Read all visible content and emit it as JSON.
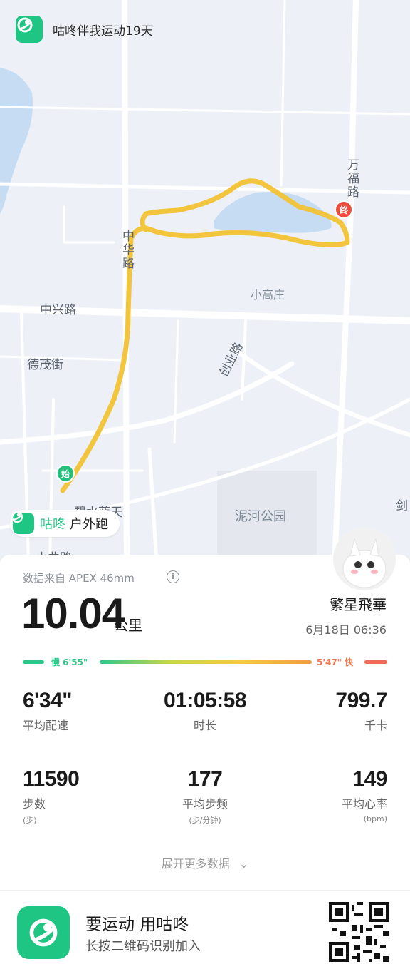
{
  "banner": {
    "text": "咕咚伴我运动19天"
  },
  "map": {
    "roads": [
      "万福路",
      "中华路",
      "中兴路",
      "德茂街",
      "创业路",
      "碧水蓝天",
      "小曲路",
      "剑"
    ],
    "places": [
      "小高庄",
      "泥河公园"
    ],
    "start_marker": "始",
    "end_marker": "终"
  },
  "sport_tag": {
    "brand": "咕咚",
    "type": "户外跑"
  },
  "summary": {
    "source": "数据来自 APEX 46mm",
    "distance": "10.04",
    "distance_unit": "公里",
    "user": "繁星飛華",
    "datetime": "6月18日 06:36"
  },
  "pace_scale": {
    "slow_label": "慢 6'55\"",
    "fast_label": "5'47\" 快"
  },
  "stats": {
    "pace": {
      "value": "6'34\"",
      "label": "平均配速"
    },
    "duration": {
      "value": "01:05:58",
      "label": "时长"
    },
    "calories": {
      "value": "799.7",
      "label": "千卡"
    },
    "steps": {
      "value": "11590",
      "label": "步数",
      "unit": "(步)"
    },
    "cadence": {
      "value": "177",
      "label": "平均步频",
      "unit": "(步/分钟)"
    },
    "heart_rate": {
      "value": "149",
      "label": "平均心率",
      "unit": "(bpm)"
    }
  },
  "more_label": "展开更多数据",
  "footer": {
    "slogan": "要运动 用咕咚",
    "sub": "长按二维码识别加入"
  },
  "colors": {
    "brand": "#1fc583",
    "track": "#f2c233",
    "slow": "#2ec78a",
    "fast": "#ee6a5a"
  }
}
